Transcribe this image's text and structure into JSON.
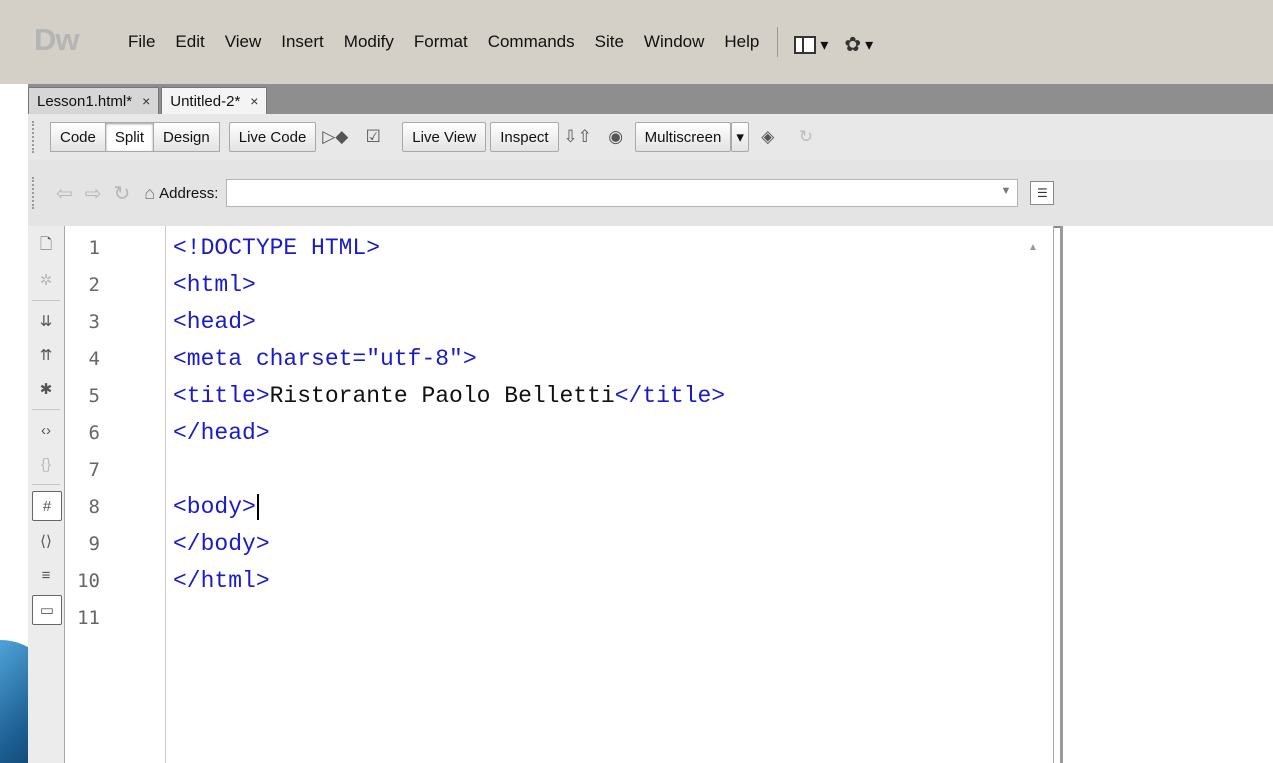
{
  "app": {
    "logo": "Dw"
  },
  "menu": [
    "File",
    "Edit",
    "View",
    "Insert",
    "Modify",
    "Format",
    "Commands",
    "Site",
    "Window",
    "Help"
  ],
  "menu_icons": [
    "layout-icon",
    "gear-icon"
  ],
  "tabs": [
    {
      "label": "Lesson1.html*",
      "close": "×",
      "active": false
    },
    {
      "label": "Untitled-2*",
      "close": "×",
      "active": true
    }
  ],
  "toolbar": {
    "view_buttons": [
      "Code",
      "Split",
      "Design"
    ],
    "active_view": "Split",
    "live_code": "Live Code",
    "live_view": "Live View",
    "inspect": "Inspect",
    "multiscreen": "Multiscreen"
  },
  "address": {
    "label": "Address:",
    "value": ""
  },
  "code": {
    "line_numbers": [
      "1",
      "2",
      "3",
      "4",
      "5",
      "6",
      "7",
      "8",
      "9",
      "10",
      "11"
    ],
    "lines": [
      "<!DOCTYPE HTML>",
      "<html>",
      "<head>",
      "<meta charset=\"utf-8\">",
      "<title>",
      "</head>",
      "",
      "<body>",
      "</body>",
      "</html>",
      ""
    ],
    "title_text": "Ristorante Paolo Belletti",
    "title_close": "</title>"
  }
}
